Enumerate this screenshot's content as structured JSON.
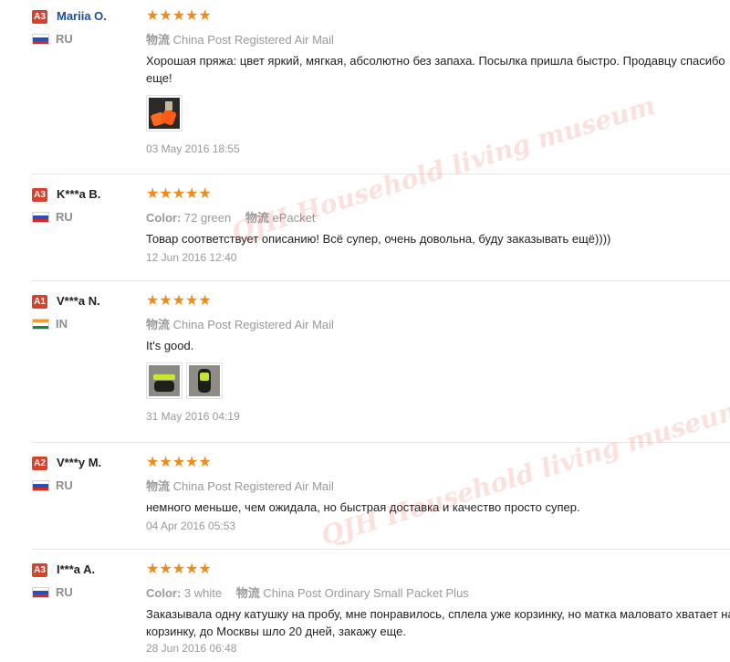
{
  "labels": {
    "shipping_label": "物流",
    "color_label": "Color:"
  },
  "colors": {
    "badge": "#d8422d",
    "star": "#f08b1a",
    "username_link": "#1a4e9e",
    "meta_text": "#999999"
  },
  "icons": {
    "star": "star-icon",
    "ru_flag": "russia-flag-icon",
    "in_flag": "india-flag-icon"
  },
  "watermark": "QJH Household living museum",
  "reviews": [
    {
      "badge": "A3",
      "name": "Mariia O.",
      "country": "RU",
      "rating": "5 of 5",
      "color": "",
      "shipping": "China Post Registered Air Mail",
      "text_lines": [
        "Хорошая пряжа: цвет яркий, мягкая, абсолютно без запаха. Посылка пришла быстро. Продавцу спасибо",
        "еще!"
      ],
      "date": "03 May 2016 18:55"
    },
    {
      "badge": "A3",
      "name": "K***a B.",
      "country": "RU",
      "rating": "5 of 5",
      "color": "72 green",
      "shipping": "ePacket",
      "text_lines": [
        "Товар соответствует описанию! Всё супер, очень довольна, буду заказывать ещё))))"
      ],
      "date": "12 Jun 2016 12:40"
    },
    {
      "badge": "A1",
      "name": "V***a N.",
      "country": "IN",
      "rating": "5 of 5",
      "color": "",
      "shipping": "China Post Registered Air Mail",
      "text_lines": [
        "It's good."
      ],
      "date": "31 May 2016 04:19"
    },
    {
      "badge": "A2",
      "name": "V***y M.",
      "country": "RU",
      "rating": "5 of 5",
      "color": "",
      "shipping": "China Post Registered Air Mail",
      "text_lines": [
        "немного меньше, чем ожидала, но быстрая доставка и качество просто супер."
      ],
      "date": "04 Apr 2016 05:53"
    },
    {
      "badge": "A3",
      "name": "I***a A.",
      "country": "RU",
      "rating": "5 of 5",
      "color": "3 white",
      "shipping": "China Post Ordinary Small Packet Plus",
      "text_lines": [
        "Заказывала одну катушку на пробу, мне понравилось, сплела уже корзинку, но матка маловато хватает на",
        "корзинку, до Москвы шло 20 дней, закажу еще."
      ],
      "date": "28 Jun 2016 06:48"
    }
  ]
}
